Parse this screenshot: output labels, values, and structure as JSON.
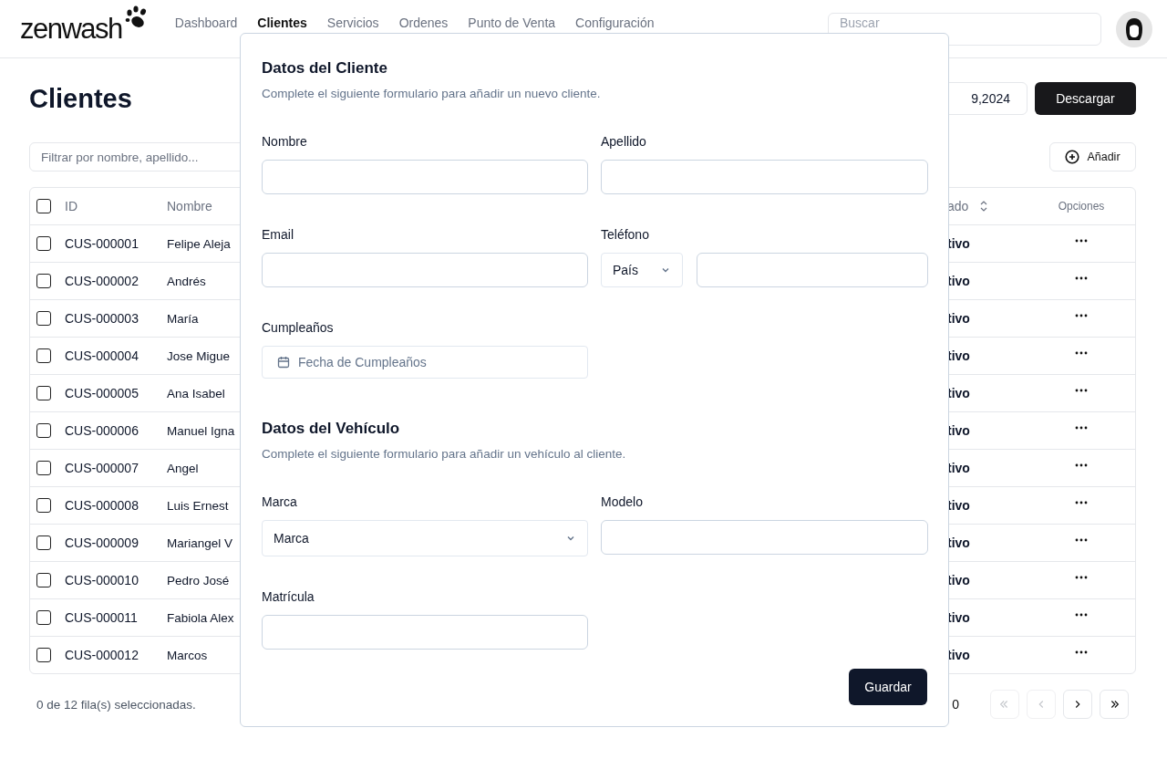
{
  "header": {
    "logo": "zenwash",
    "nav": [
      {
        "label": "Dashboard",
        "selected": false
      },
      {
        "label": "Clientes",
        "selected": true
      },
      {
        "label": "Servicios",
        "selected": false
      },
      {
        "label": "Ordenes",
        "selected": false
      },
      {
        "label": "Punto de Venta",
        "selected": false
      },
      {
        "label": "Configuración",
        "selected": false
      }
    ],
    "search": {
      "placeholder": "Buscar"
    }
  },
  "page": {
    "title": "Clientes",
    "date_range": "9,2024",
    "download": "Descargar",
    "filter": {
      "placeholder": "Filtrar por nombre, apellido..."
    },
    "add": "Añadir",
    "table": {
      "all_checked": false,
      "columns": [
        {
          "label": "ID",
          "sortable": false
        },
        {
          "label": "Nombre",
          "sortable": false
        },
        {
          "label": "ado",
          "sortable": true
        },
        {
          "label": "Opciones",
          "sortable": false
        }
      ],
      "rows": [
        {
          "id": "CUS-000001",
          "name": "Felipe Aleja",
          "status": "tivo",
          "checked": false
        },
        {
          "id": "CUS-000002",
          "name": "Andrés",
          "status": "tivo",
          "checked": false
        },
        {
          "id": "CUS-000003",
          "name": "María",
          "status": "tivo",
          "checked": false
        },
        {
          "id": "CUS-000004",
          "name": "Jose Migue",
          "status": "tivo",
          "checked": false
        },
        {
          "id": "CUS-000005",
          "name": "Ana Isabel",
          "status": "tivo",
          "checked": false
        },
        {
          "id": "CUS-000006",
          "name": "Manuel Igna",
          "status": "tivo",
          "checked": false
        },
        {
          "id": "CUS-000007",
          "name": "Angel",
          "status": "tivo",
          "checked": false
        },
        {
          "id": "CUS-000008",
          "name": "Luis Ernest",
          "status": "tivo",
          "checked": false
        },
        {
          "id": "CUS-000009",
          "name": "Mariangel V",
          "status": "tivo",
          "checked": false
        },
        {
          "id": "CUS-000010",
          "name": "Pedro José",
          "status": "tivo",
          "checked": false
        },
        {
          "id": "CUS-000011",
          "name": "Fabiola Alex",
          "status": "tivo",
          "checked": false
        },
        {
          "id": "CUS-000012",
          "name": "Marcos",
          "status": "tivo",
          "checked": false
        }
      ]
    },
    "selection_text": "0 de 12 fila(s) seleccionadas.",
    "page_label": "0",
    "pager": [
      {
        "kind": "first",
        "disabled": true
      },
      {
        "kind": "prev",
        "disabled": true
      },
      {
        "kind": "next",
        "disabled": false
      },
      {
        "kind": "last",
        "disabled": false
      }
    ]
  },
  "modal": {
    "sections": [
      {
        "title": "Datos del Cliente",
        "description": "Complete el siguiente formulario para añadir un nuevo cliente.",
        "fields": [
          {
            "kind": "text",
            "label": "Nombre"
          },
          {
            "kind": "text",
            "label": "Apellido"
          },
          {
            "kind": "text",
            "label": "Email"
          },
          {
            "kind": "phone",
            "label": "Teléfono",
            "country": "País"
          },
          {
            "kind": "date",
            "label": "Cumpleaños",
            "placeholder": "Fecha de Cumpleaños"
          }
        ]
      },
      {
        "title": "Datos del Vehículo",
        "description": "Complete el siguiente formulario para añadir un vehículo al cliente.",
        "fields": [
          {
            "kind": "select",
            "label": "Marca",
            "value": "Marca"
          },
          {
            "kind": "text",
            "label": "Modelo"
          },
          {
            "kind": "text",
            "label": "Matrícula"
          }
        ]
      }
    ],
    "save": "Guardar"
  }
}
